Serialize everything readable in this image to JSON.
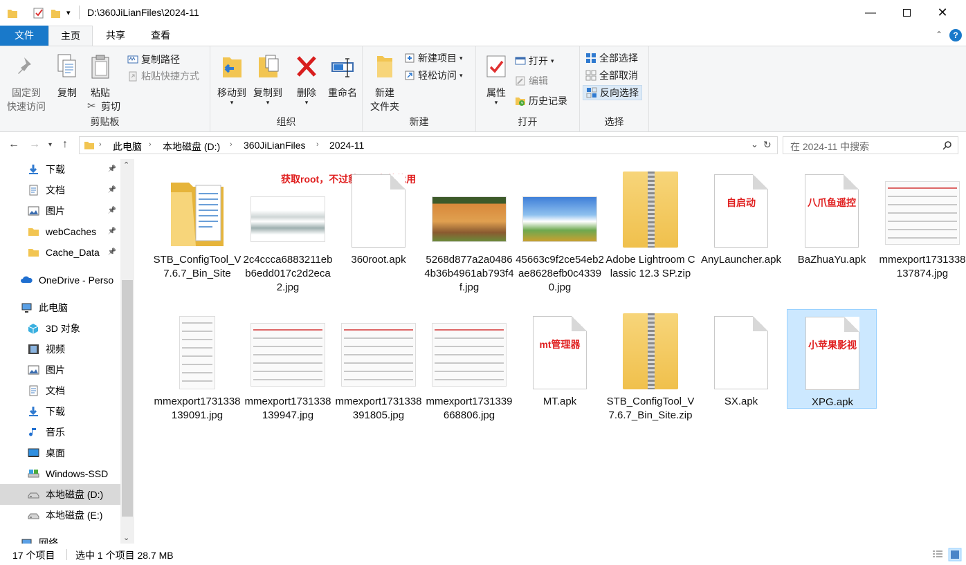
{
  "window": {
    "title": "D:\\360JiLianFiles\\2024-11"
  },
  "tabs": {
    "file": "文件",
    "home": "主页",
    "share": "共享",
    "view": "查看"
  },
  "ribbon": {
    "pin_l1": "固定到",
    "pin_l2": "快速访问",
    "copy": "复制",
    "paste": "粘贴",
    "copy_path": "复制路径",
    "paste_shortcut": "粘贴快捷方式",
    "cut": "剪切",
    "clipboard": "剪贴板",
    "move_to": "移动到",
    "copy_to": "复制到",
    "delete": "删除",
    "rename": "重命名",
    "organize": "组织",
    "new_folder_l1": "新建",
    "new_folder_l2": "文件夹",
    "new_item": "新建项目",
    "easy_access": "轻松访问",
    "new": "新建",
    "properties": "属性",
    "open": "打开",
    "edit": "编辑",
    "history": "历史记录",
    "open_group": "打开",
    "select_all": "全部选择",
    "select_none": "全部取消",
    "invert": "反向选择",
    "select_group": "选择"
  },
  "address": {
    "crumbs": [
      "此电脑",
      "本地磁盘 (D:)",
      "360JiLianFiles",
      "2024-11"
    ],
    "search_placeholder": "在 2024-11 中搜索"
  },
  "nav": [
    {
      "label": "下载",
      "pinned": true
    },
    {
      "label": "文档",
      "pinned": true
    },
    {
      "label": "图片",
      "pinned": true
    },
    {
      "label": "webCaches",
      "pinned": true
    },
    {
      "label": "Cache_Data",
      "pinned": true
    },
    {
      "label": "OneDrive - Perso"
    },
    {
      "label": "此电脑"
    },
    {
      "label": "3D 对象"
    },
    {
      "label": "视频"
    },
    {
      "label": "图片"
    },
    {
      "label": "文档"
    },
    {
      "label": "下载"
    },
    {
      "label": "音乐"
    },
    {
      "label": "桌面"
    },
    {
      "label": "Windows-SSD"
    },
    {
      "label": "本地磁盘 (D:)",
      "selected": true
    },
    {
      "label": "本地磁盘 (E:)"
    },
    {
      "label": "网络"
    }
  ],
  "annotation": "获取root，不过貌似只有他能用",
  "files": [
    {
      "name": "STB_ConfigTool_V7.6.7_Bin_Site",
      "kind": "folder"
    },
    {
      "name": "2c4ccca6883211ebb6edd017c2d2eca2.jpg",
      "kind": "img-ink"
    },
    {
      "name": "360root.apk",
      "kind": "doc",
      "label": ""
    },
    {
      "name": "5268d877a2a04864b36b4961ab793f4f.jpg",
      "kind": "img-house"
    },
    {
      "name": "45663c9f2ce54eb2ae8628efb0c43390.jpg",
      "kind": "img-sky"
    },
    {
      "name": "Adobe Lightroom Classic 12.3 SP.zip",
      "kind": "zip"
    },
    {
      "name": "AnyLauncher.apk",
      "kind": "doc",
      "label": "自启动"
    },
    {
      "name": "BaZhuaYu.apk",
      "kind": "doc",
      "label": "八爪鱼遥控"
    },
    {
      "name": "mmexport1731338137874.jpg",
      "kind": "shot-wide"
    },
    {
      "name": "mmexport1731338139091.jpg",
      "kind": "shot-tall"
    },
    {
      "name": "mmexport1731338139947.jpg",
      "kind": "shot-wide"
    },
    {
      "name": "mmexport1731338391805.jpg",
      "kind": "shot-wide"
    },
    {
      "name": "mmexport1731339668806.jpg",
      "kind": "shot-wide"
    },
    {
      "name": "MT.apk",
      "kind": "doc",
      "label": "mt管理器"
    },
    {
      "name": "STB_ConfigTool_V7.6.7_Bin_Site.zip",
      "kind": "zip"
    },
    {
      "name": "SX.apk",
      "kind": "doc",
      "label": ""
    },
    {
      "name": "XPG.apk",
      "kind": "doc",
      "label": "小苹果影视",
      "selected": true
    }
  ],
  "status": {
    "count": "17 个项目",
    "selected": "选中 1 个项目  28.7 MB"
  },
  "colors": {
    "accent": "#1979ca",
    "selection": "#cce8ff",
    "label_red": "#e02020"
  }
}
